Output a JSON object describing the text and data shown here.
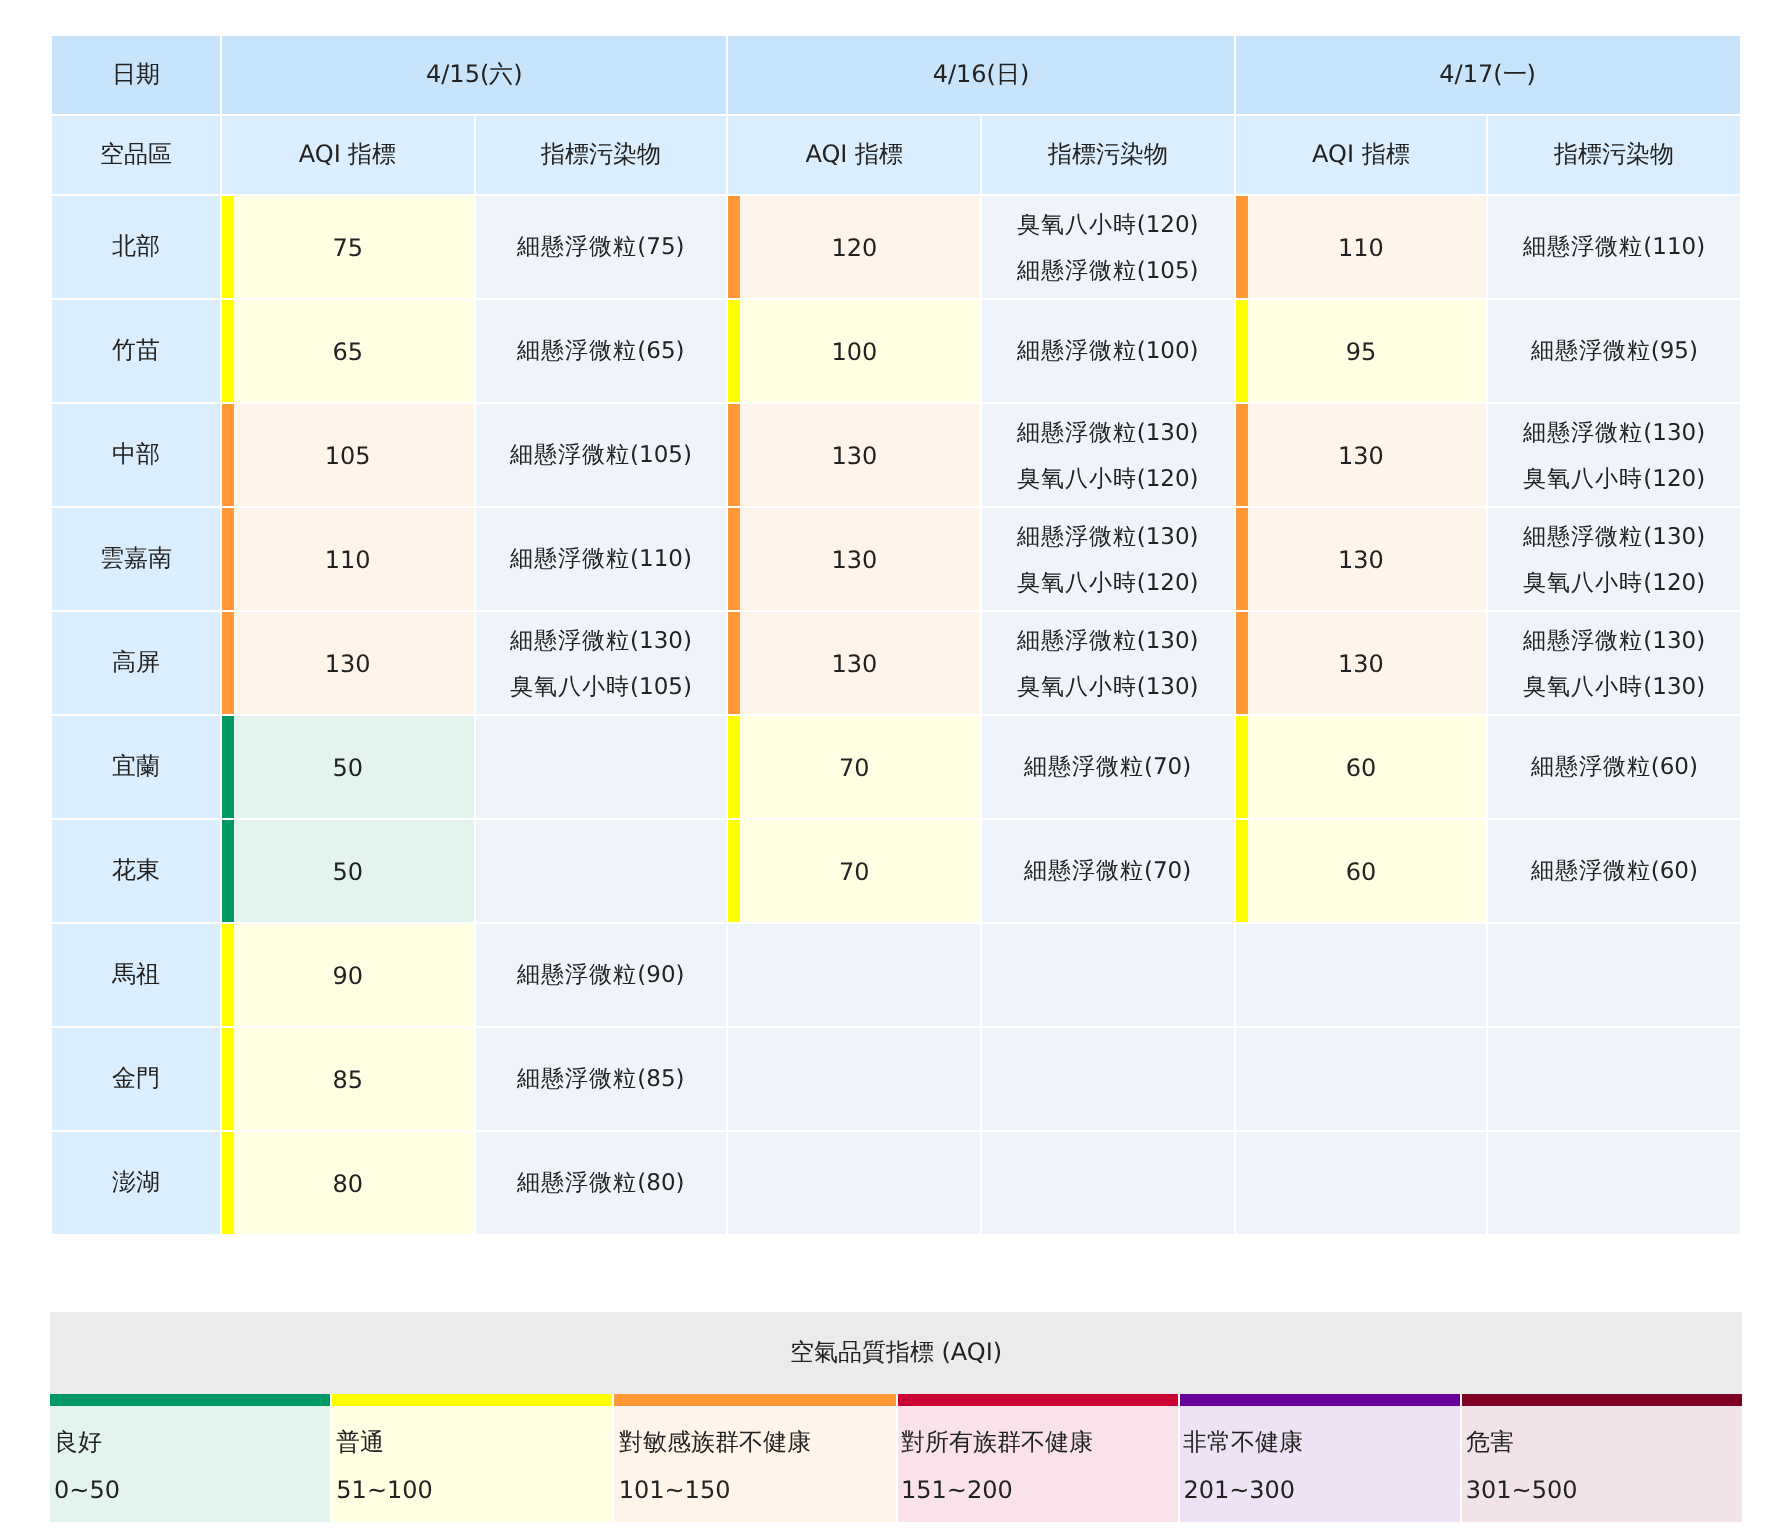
{
  "table": {
    "corner_top": "日期",
    "corner_bottom": "空品區",
    "dates": [
      "4/15(六)",
      "4/16(日)",
      "4/17(一)"
    ],
    "subheaders": [
      "AQI 指標",
      "指標污染物",
      "AQI 指標",
      "指標污染物",
      "AQI 指標",
      "指標污染物"
    ],
    "rows": [
      {
        "region": "北部",
        "forecasts": [
          {
            "aqi": "75",
            "color": "#ffff00",
            "pollutants": [
              "細懸浮微粒(75)"
            ]
          },
          {
            "aqi": "120",
            "color": "#ff9835",
            "pollutants": [
              "臭氧八小時(120)",
              "細懸浮微粒(105)"
            ]
          },
          {
            "aqi": "110",
            "color": "#ff9835",
            "pollutants": [
              "細懸浮微粒(110)"
            ]
          }
        ]
      },
      {
        "region": "竹苗",
        "forecasts": [
          {
            "aqi": "65",
            "color": "#ffff00",
            "pollutants": [
              "細懸浮微粒(65)"
            ]
          },
          {
            "aqi": "100",
            "color": "#ffff00",
            "pollutants": [
              "細懸浮微粒(100)"
            ]
          },
          {
            "aqi": "95",
            "color": "#ffff00",
            "pollutants": [
              "細懸浮微粒(95)"
            ]
          }
        ]
      },
      {
        "region": "中部",
        "forecasts": [
          {
            "aqi": "105",
            "color": "#ff9835",
            "pollutants": [
              "細懸浮微粒(105)"
            ]
          },
          {
            "aqi": "130",
            "color": "#ff9835",
            "pollutants": [
              "細懸浮微粒(130)",
              "臭氧八小時(120)"
            ]
          },
          {
            "aqi": "130",
            "color": "#ff9835",
            "pollutants": [
              "細懸浮微粒(130)",
              "臭氧八小時(120)"
            ]
          }
        ]
      },
      {
        "region": "雲嘉南",
        "forecasts": [
          {
            "aqi": "110",
            "color": "#ff9835",
            "pollutants": [
              "細懸浮微粒(110)"
            ]
          },
          {
            "aqi": "130",
            "color": "#ff9835",
            "pollutants": [
              "細懸浮微粒(130)",
              "臭氧八小時(120)"
            ]
          },
          {
            "aqi": "130",
            "color": "#ff9835",
            "pollutants": [
              "細懸浮微粒(130)",
              "臭氧八小時(120)"
            ]
          }
        ]
      },
      {
        "region": "高屏",
        "forecasts": [
          {
            "aqi": "130",
            "color": "#ff9835",
            "pollutants": [
              "細懸浮微粒(130)",
              "臭氧八小時(105)"
            ]
          },
          {
            "aqi": "130",
            "color": "#ff9835",
            "pollutants": [
              "細懸浮微粒(130)",
              "臭氧八小時(130)"
            ]
          },
          {
            "aqi": "130",
            "color": "#ff9835",
            "pollutants": [
              "細懸浮微粒(130)",
              "臭氧八小時(130)"
            ]
          }
        ]
      },
      {
        "region": "宜蘭",
        "forecasts": [
          {
            "aqi": "50",
            "color": "#009865"
          },
          {
            "aqi": "70",
            "color": "#ffff00",
            "pollutants": [
              "細懸浮微粒(70)"
            ]
          },
          {
            "aqi": "60",
            "color": "#ffff00",
            "pollutants": [
              "細懸浮微粒(60)"
            ]
          }
        ]
      },
      {
        "region": "花東",
        "forecasts": [
          {
            "aqi": "50",
            "color": "#009865"
          },
          {
            "aqi": "70",
            "color": "#ffff00",
            "pollutants": [
              "細懸浮微粒(70)"
            ]
          },
          {
            "aqi": "60",
            "color": "#ffff00",
            "pollutants": [
              "細懸浮微粒(60)"
            ]
          }
        ]
      },
      {
        "region": "馬祖",
        "forecasts": [
          {
            "aqi": "90",
            "color": "#ffff00",
            "pollutants": [
              "細懸浮微粒(90)"
            ]
          }
        ]
      },
      {
        "region": "金門",
        "forecasts": [
          {
            "aqi": "85",
            "color": "#ffff00",
            "pollutants": [
              "細懸浮微粒(85)"
            ]
          }
        ]
      },
      {
        "region": "澎湖",
        "forecasts": [
          {
            "aqi": "80",
            "color": "#ffff00",
            "pollutants": [
              "細懸浮微粒(80)"
            ]
          }
        ]
      }
    ]
  },
  "legend": {
    "title": "空氣品質指標 (AQI)",
    "levels": [
      {
        "label": "良好",
        "range": "0~50",
        "color": "#009865"
      },
      {
        "label": "普通",
        "range": "51~100",
        "color": "#ffff00"
      },
      {
        "label": "對敏感族群不健康",
        "range": "101~150",
        "color": "#ff9835"
      },
      {
        "label": "對所有族群不健康",
        "range": "151~200",
        "color": "#ca0034"
      },
      {
        "label": "非常不健康",
        "range": "201~300",
        "color": "#670099"
      },
      {
        "label": "危害",
        "range": "301~500",
        "color": "#7e0023"
      }
    ]
  }
}
